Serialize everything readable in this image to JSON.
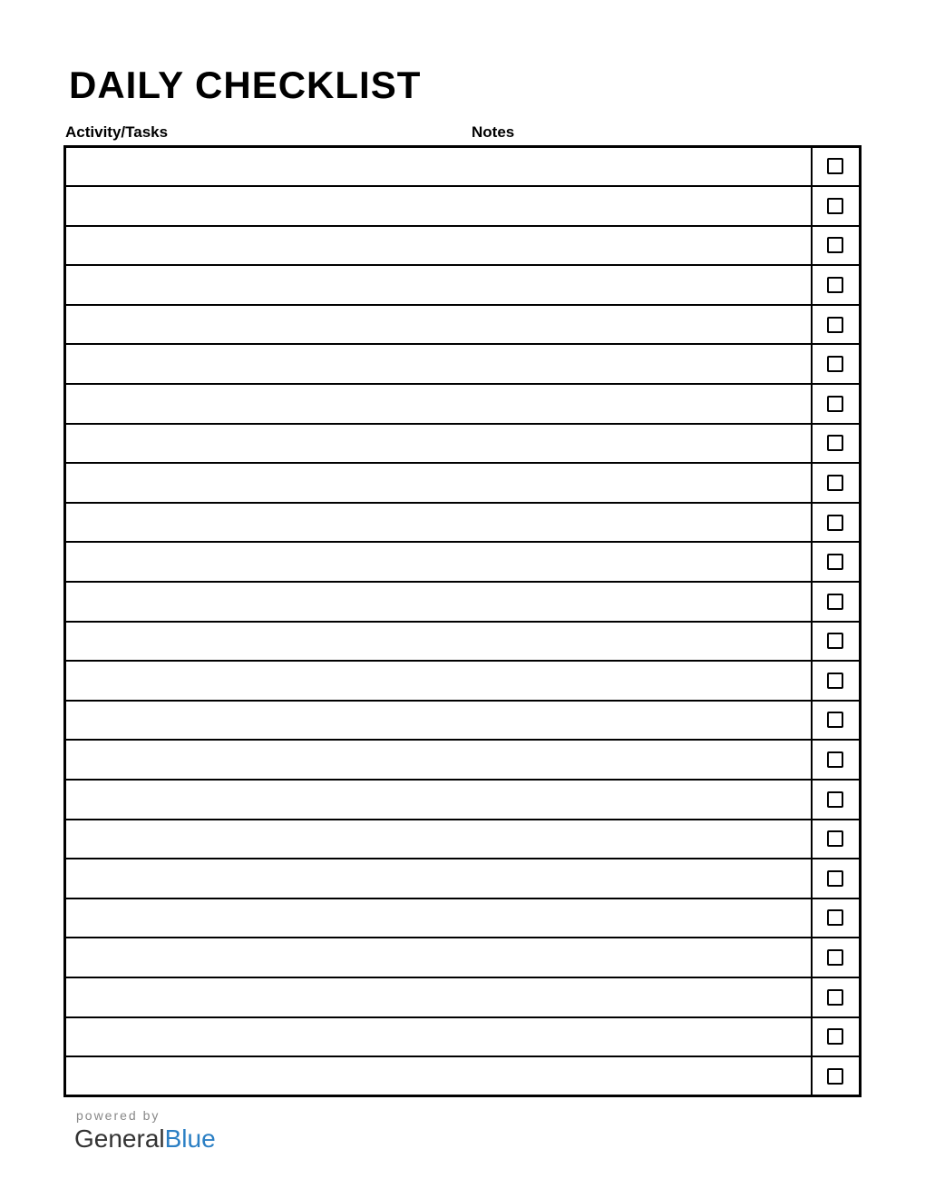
{
  "title": "DAILY CHECKLIST",
  "headers": {
    "activity": "Activity/Tasks",
    "notes": "Notes"
  },
  "rows": [
    {
      "activity": "",
      "notes": "",
      "checked": false
    },
    {
      "activity": "",
      "notes": "",
      "checked": false
    },
    {
      "activity": "",
      "notes": "",
      "checked": false
    },
    {
      "activity": "",
      "notes": "",
      "checked": false
    },
    {
      "activity": "",
      "notes": "",
      "checked": false
    },
    {
      "activity": "",
      "notes": "",
      "checked": false
    },
    {
      "activity": "",
      "notes": "",
      "checked": false
    },
    {
      "activity": "",
      "notes": "",
      "checked": false
    },
    {
      "activity": "",
      "notes": "",
      "checked": false
    },
    {
      "activity": "",
      "notes": "",
      "checked": false
    },
    {
      "activity": "",
      "notes": "",
      "checked": false
    },
    {
      "activity": "",
      "notes": "",
      "checked": false
    },
    {
      "activity": "",
      "notes": "",
      "checked": false
    },
    {
      "activity": "",
      "notes": "",
      "checked": false
    },
    {
      "activity": "",
      "notes": "",
      "checked": false
    },
    {
      "activity": "",
      "notes": "",
      "checked": false
    },
    {
      "activity": "",
      "notes": "",
      "checked": false
    },
    {
      "activity": "",
      "notes": "",
      "checked": false
    },
    {
      "activity": "",
      "notes": "",
      "checked": false
    },
    {
      "activity": "",
      "notes": "",
      "checked": false
    },
    {
      "activity": "",
      "notes": "",
      "checked": false
    },
    {
      "activity": "",
      "notes": "",
      "checked": false
    },
    {
      "activity": "",
      "notes": "",
      "checked": false
    },
    {
      "activity": "",
      "notes": "",
      "checked": false
    }
  ],
  "footer": {
    "powered_by": "powered by",
    "brand_part1": "General",
    "brand_part2": "Blue"
  }
}
